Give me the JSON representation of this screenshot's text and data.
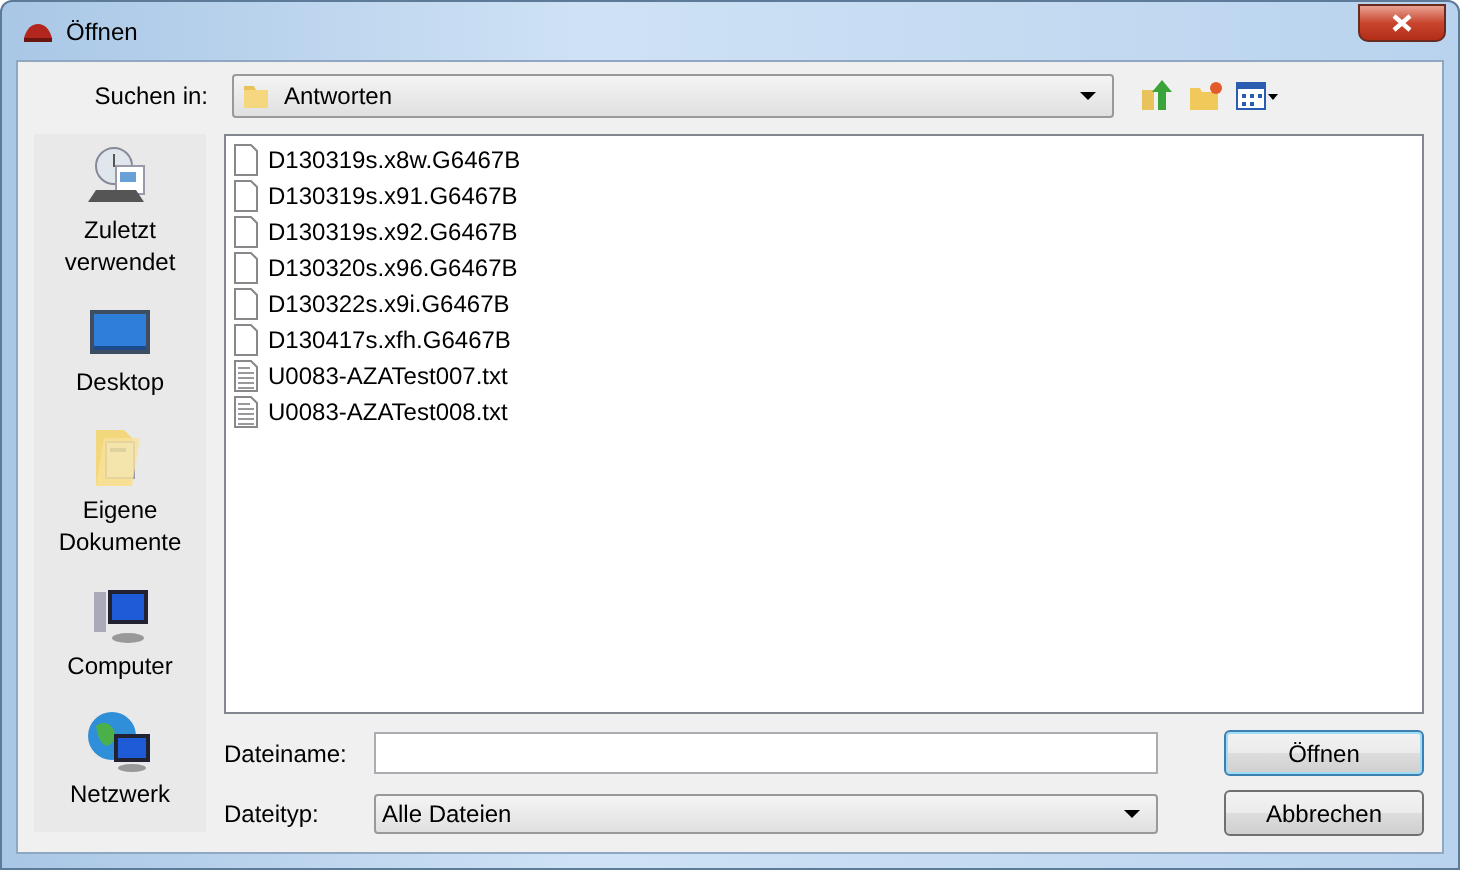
{
  "window": {
    "title": "Öffnen"
  },
  "look_in": {
    "label": "Suchen in:",
    "value": "Antworten"
  },
  "places": [
    {
      "kind": "recent",
      "label": "Zuletzt verwendet"
    },
    {
      "kind": "desktop",
      "label": "Desktop"
    },
    {
      "kind": "documents",
      "label": "Eigene Dokumente"
    },
    {
      "kind": "computer",
      "label": "Computer"
    },
    {
      "kind": "network",
      "label": "Netzwerk"
    }
  ],
  "files": [
    {
      "kind": "data",
      "name": "D130319s.x8w.G6467B"
    },
    {
      "kind": "data",
      "name": "D130319s.x91.G6467B"
    },
    {
      "kind": "data",
      "name": "D130319s.x92.G6467B"
    },
    {
      "kind": "data",
      "name": "D130320s.x96.G6467B"
    },
    {
      "kind": "data",
      "name": "D130322s.x9i.G6467B"
    },
    {
      "kind": "data",
      "name": "D130417s.xfh.G6467B"
    },
    {
      "kind": "text",
      "name": "U0083-AZATest007.txt"
    },
    {
      "kind": "text",
      "name": "U0083-AZATest008.txt"
    }
  ],
  "file_name": {
    "label": "Dateiname:"
  },
  "file_type": {
    "label": "Dateityp:",
    "value": "Alle Dateien"
  },
  "buttons": [
    {
      "label": "Öffnen",
      "default": true
    },
    {
      "label": "Abbrechen",
      "default": false
    }
  ]
}
